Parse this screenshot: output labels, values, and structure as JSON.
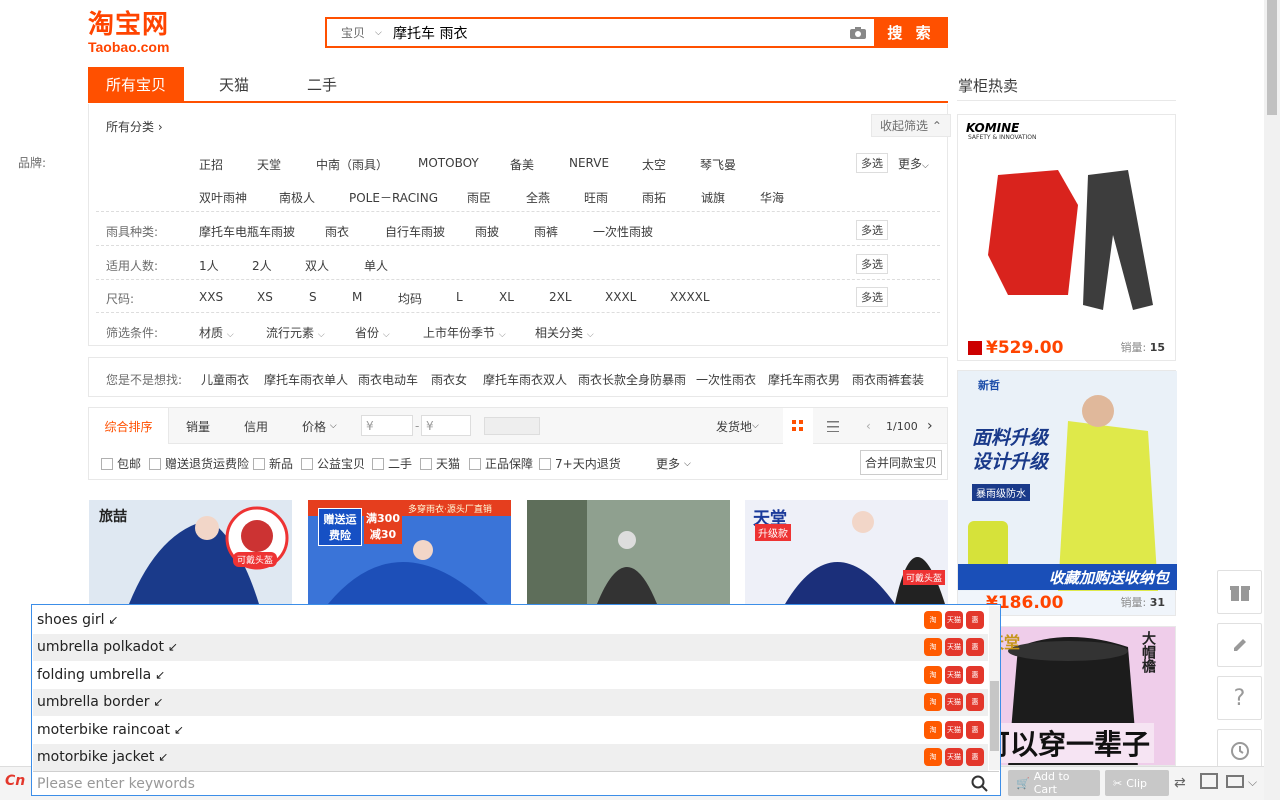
{
  "header": {
    "logo_cn": "淘宝网",
    "logo_en": "Taobao.com",
    "search_type": "宝贝",
    "search_query": "摩托车 雨衣",
    "search_button": "搜 索"
  },
  "tabs": [
    "所有宝贝",
    "天猫",
    "二手"
  ],
  "filters": {
    "all_categories": "所有分类 ›",
    "collapse": "收起筛选",
    "brand_label": "品牌:",
    "brands_row1": [
      "正招",
      "天堂",
      "中南（雨具）",
      "MOTOBOY",
      "备美",
      "NERVE",
      "太空",
      "琴飞曼"
    ],
    "brands_row2": [
      "双叶雨神",
      "南极人",
      "POLE－RACING",
      "雨臣",
      "全燕",
      "旺雨",
      "雨拓",
      "诚旗",
      "华海"
    ],
    "multi": "多选",
    "more": "更多",
    "type_label": "雨具种类:",
    "types": [
      "摩托车电瓶车雨披",
      "雨衣",
      "自行车雨披",
      "雨披",
      "雨裤",
      "一次性雨披"
    ],
    "people_label": "适用人数:",
    "people": [
      "1人",
      "2人",
      "双人",
      "单人"
    ],
    "size_label": "尺码:",
    "sizes": [
      "XXS",
      "XS",
      "S",
      "M",
      "均码",
      "L",
      "XL",
      "2XL",
      "XXXL",
      "XXXXL"
    ],
    "cond_label": "筛选条件:",
    "conds": [
      "材质",
      "流行元素",
      "省份",
      "上市年份季节",
      "相关分类"
    ]
  },
  "wish": {
    "label": "您是不是想找:",
    "items": [
      "儿童雨衣",
      "摩托车雨衣单人",
      "雨衣电动车",
      "雨衣女",
      "摩托车雨衣双人",
      "雨衣长款全身防暴雨",
      "一次性雨衣",
      "摩托车雨衣男",
      "雨衣雨裤套装"
    ]
  },
  "sort": {
    "items": [
      "综合排序",
      "销量",
      "信用",
      "价格"
    ],
    "price_ph": "¥",
    "ship": "发货地",
    "page": "1/100"
  },
  "checks": {
    "items": [
      "包邮",
      "赠送退货运费险",
      "新品",
      "公益宝贝",
      "二手",
      "天猫",
      "正品保障",
      "7+天内退货"
    ],
    "more": "更多",
    "merge": "合并同款宝贝"
  },
  "products": [
    {
      "tag": "旅喆",
      "badge": "可戴头盔"
    },
    {
      "tag": "赠送运费险",
      "tag2": "满300减30",
      "strip": "多穿雨衣·源头厂直销"
    },
    {
      "tag": ""
    },
    {
      "tag": "天堂",
      "tag2": "升级款",
      "badge": "可戴头盔"
    }
  ],
  "side": {
    "title": "掌柜热卖",
    "ads": [
      {
        "brand": "KOMINE",
        "sub": "SAFETY & INNOVATION",
        "price": "¥529.00",
        "sales_label": "销量:",
        "sales": "15"
      },
      {
        "brand": "新哲",
        "slogan1": "面料升级",
        "slogan2": "设计升级",
        "tag": "暴雨级防水",
        "banner": "收藏加购送收纳包",
        "price": "¥186.00",
        "sales_label": "销量:",
        "sales": "31"
      },
      {
        "text_big": "可以穿一辈子",
        "text_side": "大帽檐",
        "text_brand": "天堂"
      }
    ]
  },
  "suggestions": [
    "shoes girl",
    "umbrella polkadot",
    "folding umbrella",
    "umbrella border",
    "moterbike raincoat",
    "motorbike jacket"
  ],
  "suggestion_icons": [
    "淘",
    "天猫",
    "惠"
  ],
  "keyword_placeholder": "Please enter keywords",
  "bottom": {
    "logo": "Cn",
    "add_cart": "Add to Cart",
    "clip": "Clip"
  },
  "colors": {
    "accent": "#ff5000",
    "price": "#ff4400",
    "popup_border": "#3c8ee8"
  }
}
